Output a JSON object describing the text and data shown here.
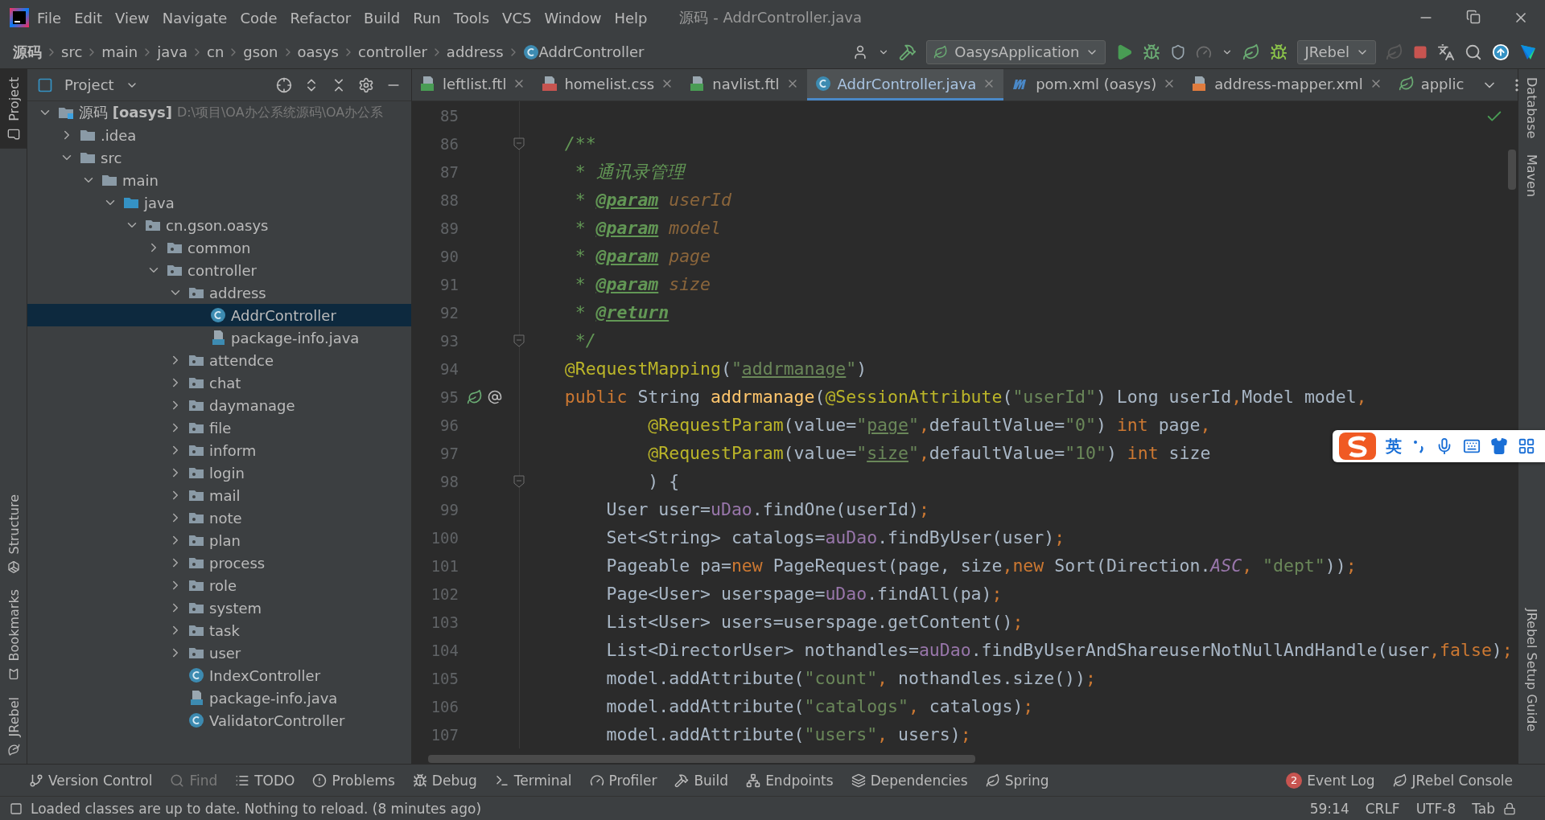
{
  "window": {
    "title": "源码 - AddrController.java"
  },
  "menu": [
    "File",
    "Edit",
    "View",
    "Navigate",
    "Code",
    "Refactor",
    "Build",
    "Run",
    "Tools",
    "VCS",
    "Window",
    "Help"
  ],
  "breadcrumbs": [
    {
      "label": "源码",
      "kind": "module"
    },
    {
      "label": "src",
      "kind": "folder"
    },
    {
      "label": "main",
      "kind": "folder"
    },
    {
      "label": "java",
      "kind": "folder"
    },
    {
      "label": "cn",
      "kind": "folder"
    },
    {
      "label": "gson",
      "kind": "folder"
    },
    {
      "label": "oasys",
      "kind": "folder"
    },
    {
      "label": "controller",
      "kind": "folder"
    },
    {
      "label": "address",
      "kind": "folder"
    },
    {
      "label": "AddrController",
      "kind": "class"
    }
  ],
  "toolbar": {
    "run_config": "OasysApplication",
    "jrebel": "JRebel"
  },
  "project_panel": {
    "title": "Project",
    "tree": [
      {
        "label": "源码 **[oasys]**",
        "path": "D:\\项目\\OA办公系统源码\\OA办公系",
        "kind": "module",
        "expanded": true,
        "selected": false,
        "children": [
          {
            "label": ".idea",
            "kind": "folder",
            "expanded": false,
            "selected": false
          },
          {
            "label": "src",
            "kind": "folder",
            "expanded": true,
            "selected": false,
            "children": [
              {
                "label": "main",
                "kind": "folder",
                "expanded": true,
                "selected": false,
                "children": [
                  {
                    "label": "java",
                    "kind": "source",
                    "expanded": true,
                    "selected": false,
                    "children": [
                      {
                        "label": "cn.gson.oasys",
                        "kind": "package",
                        "expanded": true,
                        "selected": false,
                        "children": [
                          {
                            "label": "common",
                            "kind": "package",
                            "expanded": false,
                            "selected": false
                          },
                          {
                            "label": "controller",
                            "kind": "package",
                            "expanded": true,
                            "selected": false,
                            "children": [
                              {
                                "label": "address",
                                "kind": "package",
                                "expanded": true,
                                "selected": false,
                                "children": [
                                  {
                                    "label": "AddrController",
                                    "kind": "class",
                                    "selected": true
                                  },
                                  {
                                    "label": "package-info.java",
                                    "kind": "java",
                                    "selected": false
                                  }
                                ]
                              },
                              {
                                "label": "attendce",
                                "kind": "package",
                                "expanded": false,
                                "selected": false
                              },
                              {
                                "label": "chat",
                                "kind": "package",
                                "expanded": false,
                                "selected": false
                              },
                              {
                                "label": "daymanage",
                                "kind": "package",
                                "expanded": false,
                                "selected": false
                              },
                              {
                                "label": "file",
                                "kind": "package",
                                "expanded": false,
                                "selected": false
                              },
                              {
                                "label": "inform",
                                "kind": "package",
                                "expanded": false,
                                "selected": false
                              },
                              {
                                "label": "login",
                                "kind": "package",
                                "expanded": false,
                                "selected": false
                              },
                              {
                                "label": "mail",
                                "kind": "package",
                                "expanded": false,
                                "selected": false
                              },
                              {
                                "label": "note",
                                "kind": "package",
                                "expanded": false,
                                "selected": false
                              },
                              {
                                "label": "plan",
                                "kind": "package",
                                "expanded": false,
                                "selected": false
                              },
                              {
                                "label": "process",
                                "kind": "package",
                                "expanded": false,
                                "selected": false
                              },
                              {
                                "label": "role",
                                "kind": "package",
                                "expanded": false,
                                "selected": false
                              },
                              {
                                "label": "system",
                                "kind": "package",
                                "expanded": false,
                                "selected": false
                              },
                              {
                                "label": "task",
                                "kind": "package",
                                "expanded": false,
                                "selected": false
                              },
                              {
                                "label": "user",
                                "kind": "package",
                                "expanded": false,
                                "selected": false
                              },
                              {
                                "label": "IndexController",
                                "kind": "class",
                                "selected": false
                              },
                              {
                                "label": "package-info.java",
                                "kind": "java",
                                "selected": false
                              },
                              {
                                "label": "ValidatorController",
                                "kind": "class",
                                "selected": false
                              }
                            ]
                          }
                        ]
                      }
                    ]
                  }
                ]
              }
            ]
          }
        ]
      }
    ]
  },
  "left_strip": [
    {
      "label": "Project",
      "selected": true
    },
    {
      "label": "Structure",
      "selected": false
    },
    {
      "label": "Bookmarks",
      "selected": false
    },
    {
      "label": "JRebel",
      "selected": false
    }
  ],
  "right_strip": [
    "Database",
    "Maven",
    "JRebel Setup Guide"
  ],
  "tabs": [
    {
      "label": "leftlist.ftl",
      "kind": "ftl",
      "selected": false
    },
    {
      "label": "homelist.css",
      "kind": "css",
      "selected": false
    },
    {
      "label": "navlist.ftl",
      "kind": "ftl",
      "selected": false
    },
    {
      "label": "AddrController.java",
      "kind": "class",
      "selected": true
    },
    {
      "label": "pom.xml (oasys)",
      "kind": "maven",
      "selected": false
    },
    {
      "label": "address-mapper.xml",
      "kind": "xml",
      "selected": false
    },
    {
      "label": "applic",
      "kind": "spring",
      "selected": false
    }
  ],
  "editor": {
    "lines": [
      {
        "number": "85"
      },
      {
        "number": "86",
        "fold": true,
        "tokens": [
          {
            "text": "    /**",
            "kind": "comment"
          }
        ]
      },
      {
        "number": "87",
        "tokens": [
          {
            "text": "     * 通讯录管理",
            "kind": "comment"
          }
        ]
      },
      {
        "number": "88",
        "tokens": [
          {
            "text": "     * ",
            "kind": "comment"
          },
          {
            "text": "@param",
            "kind": "doctag"
          },
          {
            "text": " userId",
            "kind": "docparam"
          }
        ]
      },
      {
        "number": "89",
        "tokens": [
          {
            "text": "     * ",
            "kind": "comment"
          },
          {
            "text": "@param",
            "kind": "doctag"
          },
          {
            "text": " model",
            "kind": "docparam"
          }
        ]
      },
      {
        "number": "90",
        "tokens": [
          {
            "text": "     * ",
            "kind": "comment"
          },
          {
            "text": "@param",
            "kind": "doctag"
          },
          {
            "text": " page",
            "kind": "docparam"
          }
        ]
      },
      {
        "number": "91",
        "tokens": [
          {
            "text": "     * ",
            "kind": "comment"
          },
          {
            "text": "@param",
            "kind": "doctag"
          },
          {
            "text": " size",
            "kind": "docparam"
          }
        ]
      },
      {
        "number": "92",
        "tokens": [
          {
            "text": "     * ",
            "kind": "comment"
          },
          {
            "text": "@return",
            "kind": "doctag"
          }
        ]
      },
      {
        "number": "93",
        "fold": true,
        "tokens": [
          {
            "text": "     */",
            "kind": "comment"
          }
        ]
      },
      {
        "number": "94",
        "tokens": [
          {
            "text": "    @RequestMapping",
            "kind": "ann"
          },
          {
            "text": "(",
            "kind": "plain"
          },
          {
            "text": "\"",
            "kind": "str"
          },
          {
            "text": "addrmanage",
            "kind": "strlink"
          },
          {
            "text": "\"",
            "kind": "str"
          },
          {
            "text": ")",
            "kind": "plain"
          }
        ]
      },
      {
        "number": "95",
        "bean": true,
        "tokens": [
          {
            "text": "    public ",
            "kind": "kw"
          },
          {
            "text": "String ",
            "kind": "plain"
          },
          {
            "text": "addrmanage",
            "kind": "fn"
          },
          {
            "text": "(",
            "kind": "plain"
          },
          {
            "text": "@SessionAttribute",
            "kind": "ann"
          },
          {
            "text": "(",
            "kind": "plain"
          },
          {
            "text": "\"userId\"",
            "kind": "str"
          },
          {
            "text": ") Long userId",
            "kind": "plain"
          },
          {
            "text": ",",
            "kind": "kw"
          },
          {
            "text": "Model model",
            "kind": "plain"
          },
          {
            "text": ",",
            "kind": "kw"
          }
        ]
      },
      {
        "number": "96",
        "tokens": [
          {
            "text": "            @RequestParam",
            "kind": "ann"
          },
          {
            "text": "(value=",
            "kind": "plain"
          },
          {
            "text": "\"",
            "kind": "str"
          },
          {
            "text": "page",
            "kind": "strlink"
          },
          {
            "text": "\"",
            "kind": "str"
          },
          {
            "text": ",",
            "kind": "kw"
          },
          {
            "text": "defaultValue=",
            "kind": "plain"
          },
          {
            "text": "\"0\"",
            "kind": "str"
          },
          {
            "text": ") ",
            "kind": "plain"
          },
          {
            "text": "int ",
            "kind": "kw"
          },
          {
            "text": "page",
            "kind": "plain"
          },
          {
            "text": ",",
            "kind": "kw"
          }
        ]
      },
      {
        "number": "97",
        "tokens": [
          {
            "text": "            @RequestParam",
            "kind": "ann"
          },
          {
            "text": "(value=",
            "kind": "plain"
          },
          {
            "text": "\"",
            "kind": "str"
          },
          {
            "text": "size",
            "kind": "strlink"
          },
          {
            "text": "\"",
            "kind": "str"
          },
          {
            "text": ",",
            "kind": "kw"
          },
          {
            "text": "defaultValue=",
            "kind": "plain"
          },
          {
            "text": "\"10\"",
            "kind": "str"
          },
          {
            "text": ") ",
            "kind": "plain"
          },
          {
            "text": "int ",
            "kind": "kw"
          },
          {
            "text": "size",
            "kind": "plain"
          }
        ]
      },
      {
        "number": "98",
        "fold": true,
        "tokens": [
          {
            "text": "            ) {",
            "kind": "plain"
          }
        ]
      },
      {
        "number": "99",
        "tokens": [
          {
            "text": "        User user=",
            "kind": "plain"
          },
          {
            "text": "uDao",
            "kind": "field"
          },
          {
            "text": ".findOne(userId)",
            "kind": "plain"
          },
          {
            "text": ";",
            "kind": "kw"
          }
        ]
      },
      {
        "number": "100",
        "tokens": [
          {
            "text": "        Set<String> catalogs=",
            "kind": "plain"
          },
          {
            "text": "auDao",
            "kind": "field"
          },
          {
            "text": ".findByUser(user)",
            "kind": "plain"
          },
          {
            "text": ";",
            "kind": "kw"
          }
        ]
      },
      {
        "number": "101",
        "tokens": [
          {
            "text": "        Pageable pa=",
            "kind": "plain"
          },
          {
            "text": "new ",
            "kind": "kw"
          },
          {
            "text": "PageRequest(page, size",
            "kind": "plain"
          },
          {
            "text": ",",
            "kind": "kw"
          },
          {
            "text": "new ",
            "kind": "kw"
          },
          {
            "text": "Sort(Direction.",
            "kind": "plain"
          },
          {
            "text": "ASC",
            "kind": "const"
          },
          {
            "text": ", ",
            "kind": "kw"
          },
          {
            "text": "\"dept\"",
            "kind": "str"
          },
          {
            "text": "))",
            "kind": "plain"
          },
          {
            "text": ";",
            "kind": "kw"
          }
        ]
      },
      {
        "number": "102",
        "tokens": [
          {
            "text": "        Page<User> userspage=",
            "kind": "plain"
          },
          {
            "text": "uDao",
            "kind": "field"
          },
          {
            "text": ".findAll(pa)",
            "kind": "plain"
          },
          {
            "text": ";",
            "kind": "kw"
          }
        ]
      },
      {
        "number": "103",
        "tokens": [
          {
            "text": "        List<User> users=userspage.getContent()",
            "kind": "plain"
          },
          {
            "text": ";",
            "kind": "kw"
          }
        ]
      },
      {
        "number": "104",
        "tokens": [
          {
            "text": "        List<DirectorUser> nothandles=",
            "kind": "plain"
          },
          {
            "text": "auDao",
            "kind": "field"
          },
          {
            "text": ".findByUserAndShareuserNotNullAndHandle(user",
            "kind": "plain"
          },
          {
            "text": ",false",
            "kind": "kw"
          },
          {
            "text": ")",
            "kind": "plain"
          },
          {
            "text": ";",
            "kind": "kw"
          }
        ]
      },
      {
        "number": "105",
        "tokens": [
          {
            "text": "        model.addAttribute(",
            "kind": "plain"
          },
          {
            "text": "\"count\"",
            "kind": "str"
          },
          {
            "text": ", ",
            "kind": "kw"
          },
          {
            "text": "nothandles.size())",
            "kind": "plain"
          },
          {
            "text": ";",
            "kind": "kw"
          }
        ]
      },
      {
        "number": "106",
        "tokens": [
          {
            "text": "        model.addAttribute(",
            "kind": "plain"
          },
          {
            "text": "\"catalogs\"",
            "kind": "str"
          },
          {
            "text": ", ",
            "kind": "kw"
          },
          {
            "text": "catalogs)",
            "kind": "plain"
          },
          {
            "text": ";",
            "kind": "kw"
          }
        ]
      },
      {
        "number": "107",
        "tokens": [
          {
            "text": "        model.addAttribute(",
            "kind": "plain"
          },
          {
            "text": "\"users\"",
            "kind": "str"
          },
          {
            "text": ", ",
            "kind": "kw"
          },
          {
            "text": "users)",
            "kind": "plain"
          },
          {
            "text": ";",
            "kind": "kw"
          }
        ]
      }
    ]
  },
  "ime": {
    "mode": "英"
  },
  "bottom_tools": [
    {
      "label": "Version Control",
      "disabled": false
    },
    {
      "label": "Find",
      "disabled": true
    },
    {
      "label": "TODO",
      "disabled": false
    },
    {
      "label": "Problems",
      "disabled": false
    },
    {
      "label": "Debug",
      "disabled": false
    },
    {
      "label": "Terminal",
      "disabled": false
    },
    {
      "label": "Profiler",
      "disabled": false
    },
    {
      "label": "Build",
      "disabled": false
    },
    {
      "label": "Endpoints",
      "disabled": false
    },
    {
      "label": "Dependencies",
      "disabled": false
    },
    {
      "label": "Spring",
      "disabled": false
    }
  ],
  "right_tools": [
    {
      "label": "Event Log",
      "badge": "2"
    },
    {
      "label": "JRebel Console"
    }
  ],
  "status_bar": {
    "message": "Loaded classes are up to date. Nothing to reload. (8 minutes ago)",
    "items": [
      "59:14",
      "CRLF",
      "UTF-8",
      "Tab"
    ]
  }
}
